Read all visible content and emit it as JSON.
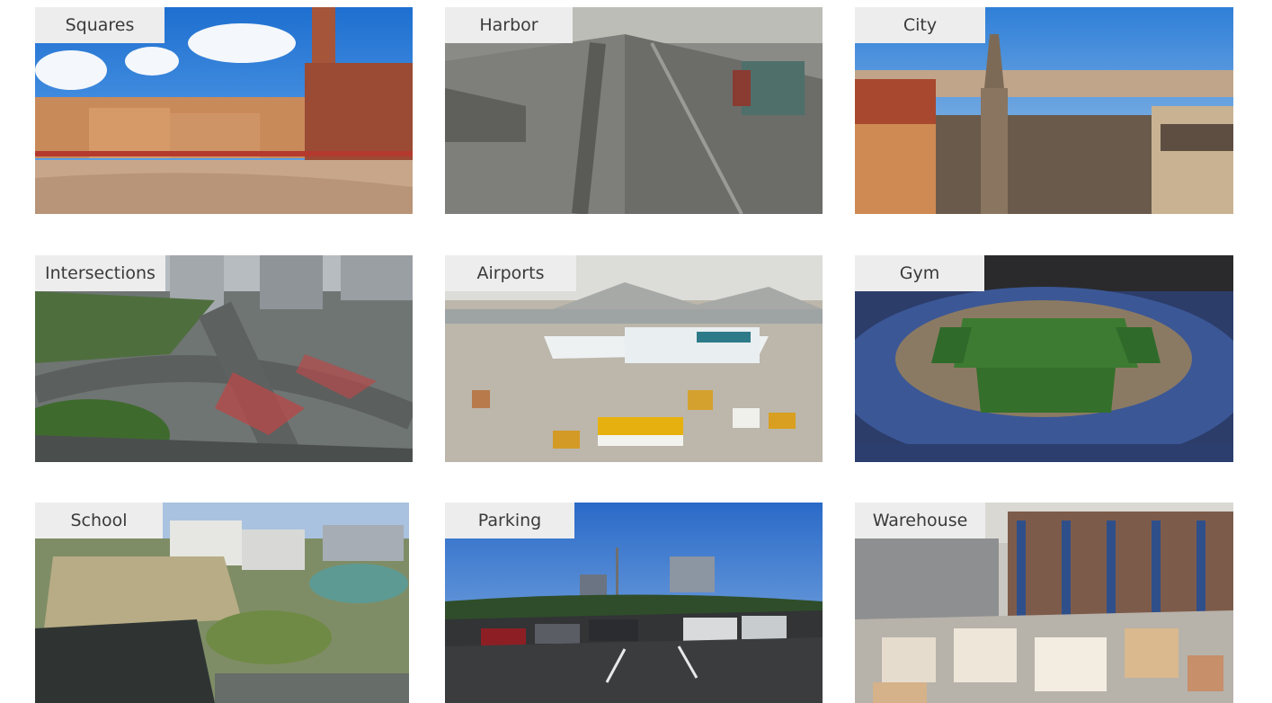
{
  "gallery": {
    "tiles": [
      {
        "label": "Squares"
      },
      {
        "label": "Harbor"
      },
      {
        "label": "City"
      },
      {
        "label": "Intersections"
      },
      {
        "label": "Airports"
      },
      {
        "label": "Gym"
      },
      {
        "label": "School"
      },
      {
        "label": "Parking"
      },
      {
        "label": "Warehouse"
      }
    ]
  }
}
